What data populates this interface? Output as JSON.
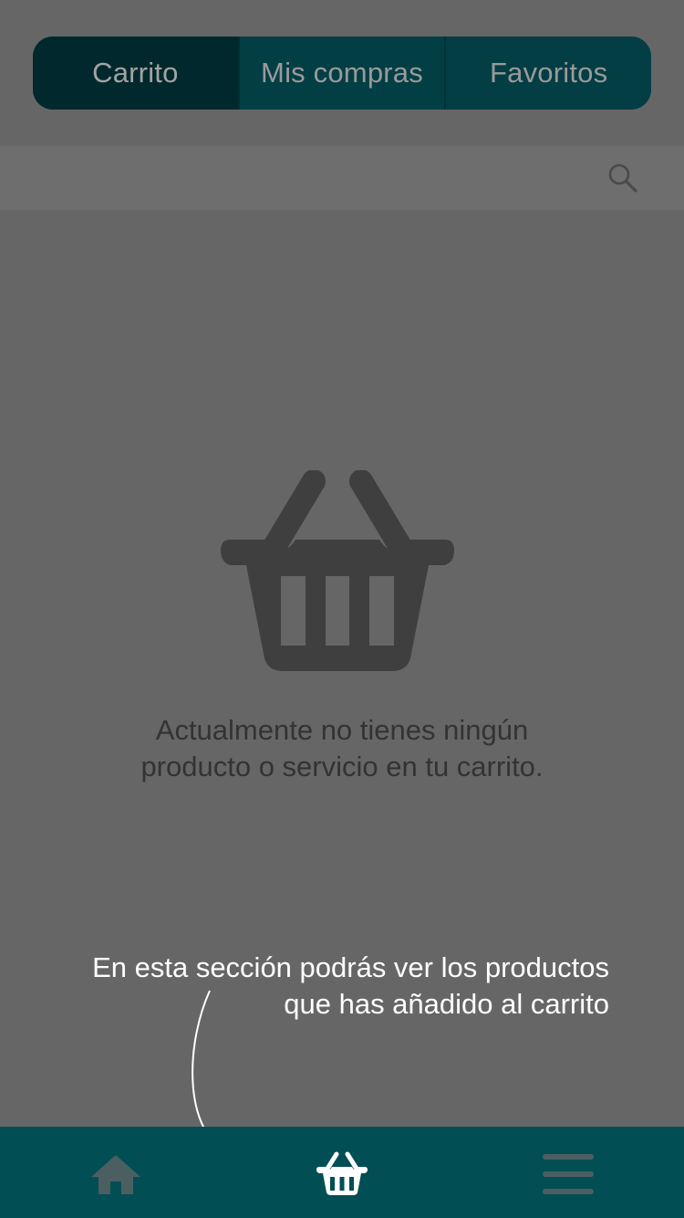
{
  "tabs": [
    {
      "label": "Carrito",
      "active": true
    },
    {
      "label": "Mis compras",
      "active": false
    },
    {
      "label": "Favoritos",
      "active": false
    }
  ],
  "search": {
    "icon": "search-icon"
  },
  "empty_state": {
    "icon": "basket-icon",
    "line1": "Actualmente no tienes ningún",
    "line2": "producto o servicio en tu carrito."
  },
  "hint": {
    "line1": "En esta sección podrás ver los productos",
    "line2": "que has añadido al carrito"
  },
  "bottom_nav": {
    "items": [
      {
        "icon": "home-icon"
      },
      {
        "icon": "basket-icon",
        "active": true
      },
      {
        "icon": "menu-icon"
      }
    ]
  },
  "colors": {
    "overlay_bg": "#666666",
    "tabbar_bg": "#024e55",
    "segment_active": "#01292d",
    "segment_inactive": "#023e44"
  }
}
